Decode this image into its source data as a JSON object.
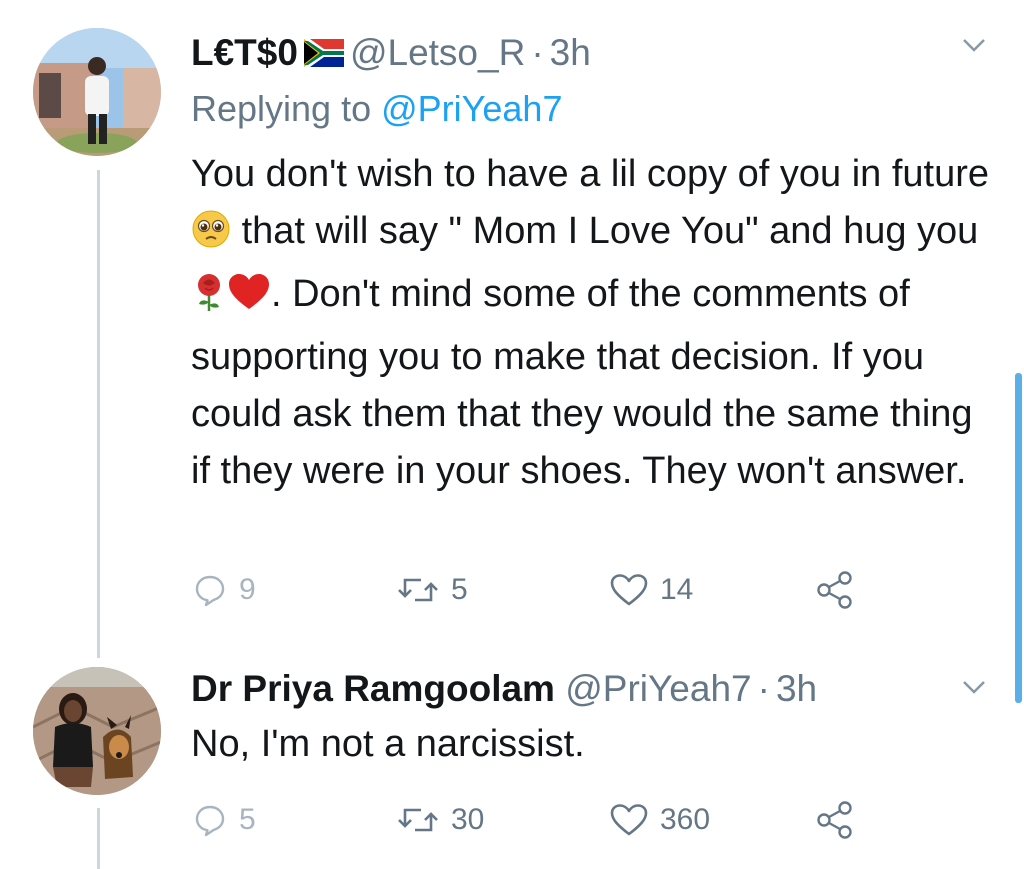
{
  "tweets": [
    {
      "name": "L€T$0",
      "handle": "@Letso_R",
      "separator": "·",
      "time": "3h",
      "flag_icon": "south-africa-flag-icon",
      "replying_prefix": "Replying to",
      "replying_handle": "@PriYeah7",
      "text_parts": {
        "a": "You don't wish to have a lil copy of you in future",
        "b": "that will say \" Mom I Love You\" and hug you",
        "c": ". Don't mind some of the comments of supporting you to make that decision. If you could ask them that they would the same thing if they were in your shoes. They won't answer."
      },
      "emojis": [
        "pleading-face-emoji",
        "rose-emoji",
        "red-heart-emoji"
      ],
      "actions": {
        "replies": "9",
        "retweets": "5",
        "likes": "14"
      }
    },
    {
      "name": "Dr Priya Ramgoolam",
      "handle": "@PriYeah7",
      "separator": "·",
      "time": "3h",
      "text": "No, I'm not a narcissist.",
      "actions": {
        "replies": "5",
        "retweets": "30",
        "likes": "360"
      }
    }
  ],
  "colors": {
    "text": "#14171a",
    "secondary": "#657786",
    "accent": "#1da1f2",
    "thread_line": "#ccd6dd"
  }
}
